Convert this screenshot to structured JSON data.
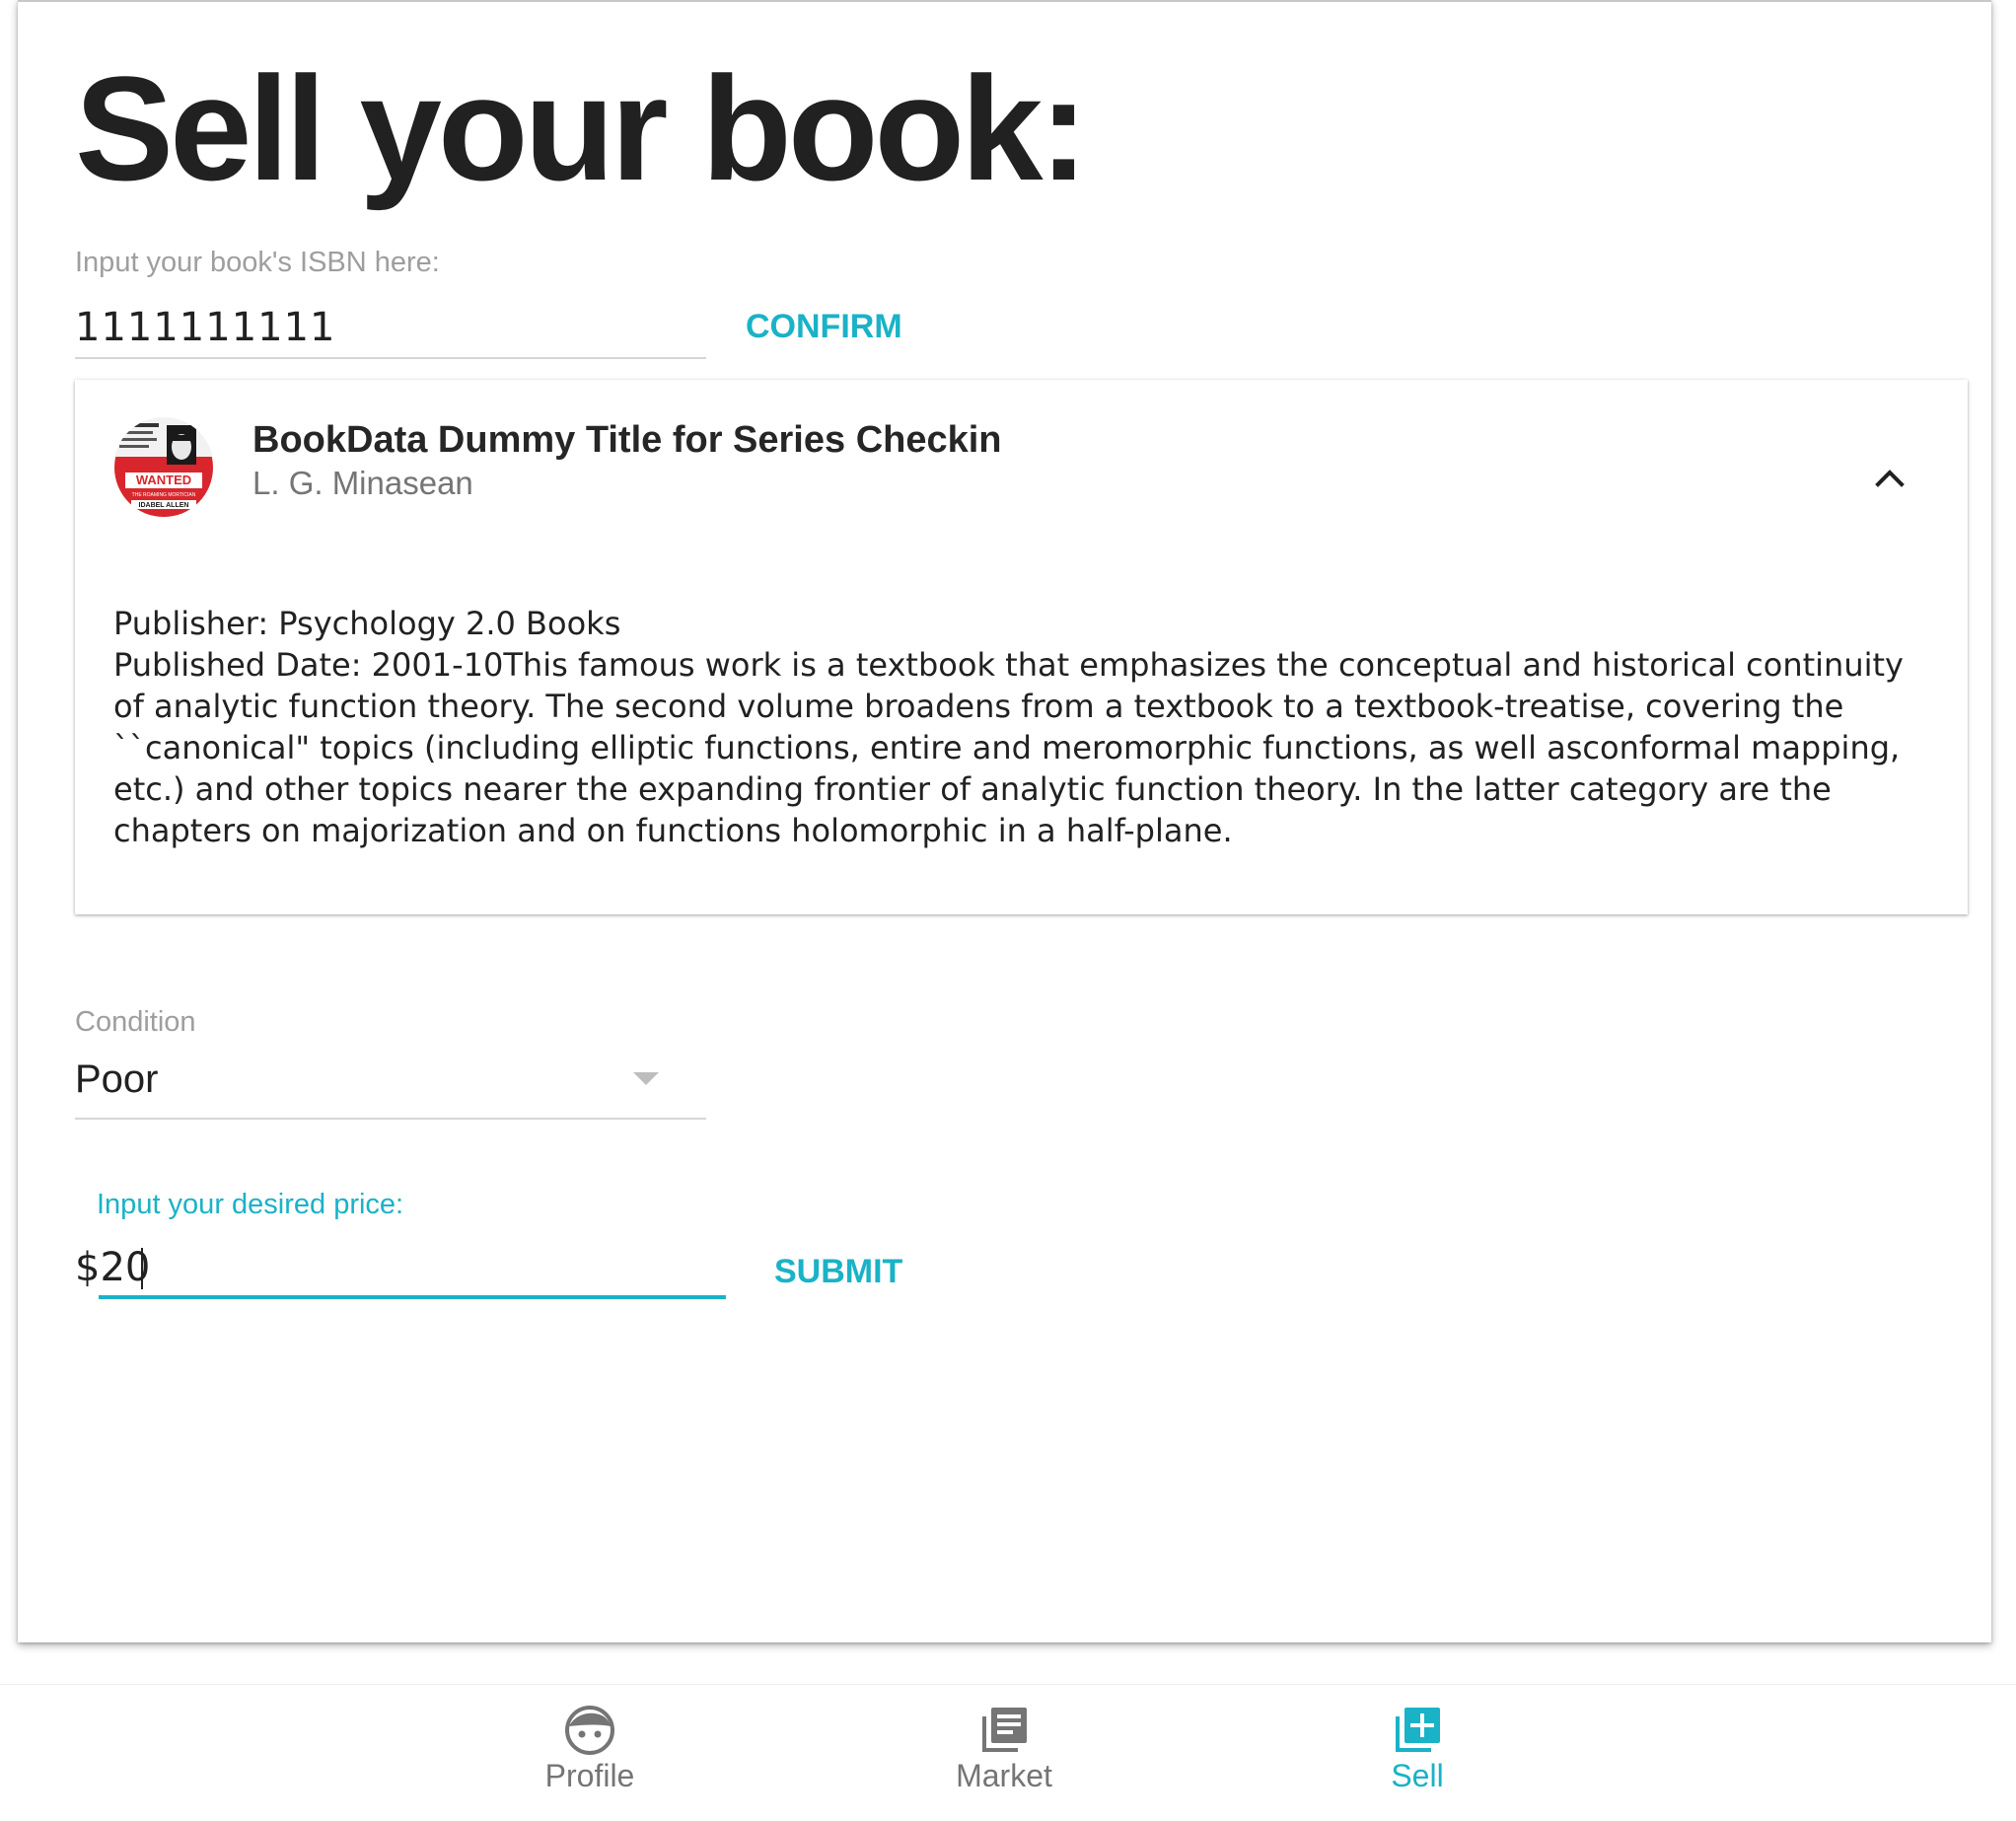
{
  "page": {
    "title": "Sell your book:"
  },
  "isbn": {
    "label": "Input your book's ISBN here:",
    "value": "1111111111",
    "confirm_label": "CONFIRM"
  },
  "book": {
    "title": "BookData Dummy Title for Series Checkin",
    "author": "L. G. Minasean",
    "publisher": "Publisher: Psychology 2.0 Books",
    "published_and_description": "Published Date: 2001-10This famous work is a textbook that emphasizes the conceptual and historical continuity of analytic function theory. The second volume broadens from a textbook to a textbook-treatise, covering the ``canonical\" topics (including elliptic functions, entire and meromorphic functions, as well asconformal mapping, etc.) and other topics nearer the expanding frontier of analytic function theory. In the latter category are the chapters on majorization and on functions holomorphic in a half-plane.",
    "cover_text": {
      "wanted": "WANTED",
      "subtitle": "THE ROAMING MORTICIAN",
      "name": "IDABEL ALLEN"
    },
    "expanded": true
  },
  "condition": {
    "label": "Condition",
    "value": "Poor"
  },
  "price": {
    "label": "Input your desired price:",
    "value": "$20",
    "submit_label": "SUBMIT"
  },
  "bottom_nav": {
    "items": [
      {
        "label": "Profile",
        "icon": "face-icon",
        "active": false
      },
      {
        "label": "Market",
        "icon": "library-books-icon",
        "active": false
      },
      {
        "label": "Sell",
        "icon": "add-box-icon",
        "active": true
      }
    ]
  },
  "colors": {
    "accent": "#1ab2c7",
    "text_primary": "#212121",
    "text_secondary": "#757575",
    "label_gray": "#9e9e9e"
  }
}
